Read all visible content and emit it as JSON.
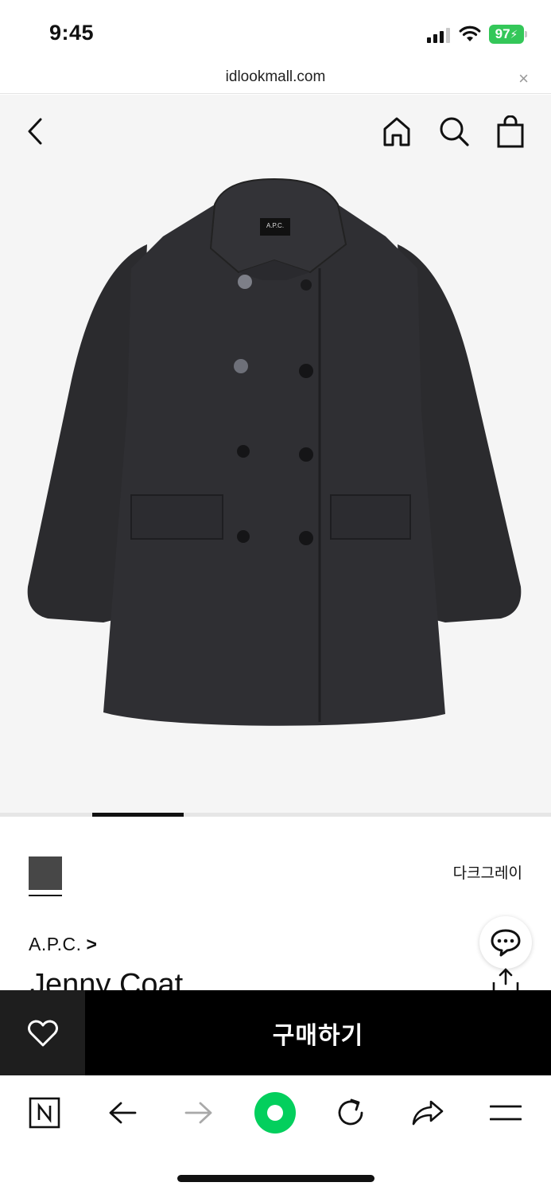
{
  "status_bar": {
    "time": "9:45",
    "battery": "97",
    "icons": [
      "cellular-signal-icon",
      "wifi-icon",
      "battery-charging-icon"
    ]
  },
  "url_bar": {
    "url": "idlookmall.com",
    "close_label": "×"
  },
  "header": {
    "icons": [
      "back-arrow-icon",
      "home-icon",
      "search-icon",
      "shopping-bag-icon"
    ]
  },
  "product": {
    "image_label": "A.P.C.",
    "color_name": "다크그레이",
    "swatch_color": "#474747",
    "brand": "A.P.C.",
    "brand_chevron": ">",
    "name": "Jenny Coat"
  },
  "carousel": {
    "current": 1,
    "total": 6
  },
  "purchase_bar": {
    "buy_label": "구매하기",
    "wish_icon": "heart-icon"
  },
  "browser_toolbar": {
    "icons": [
      "naver-n-icon",
      "back-icon",
      "forward-icon",
      "green-circle-icon",
      "reload-icon",
      "share-icon",
      "menu-icon"
    ]
  },
  "colors": {
    "hero_background": "#f5f5f5",
    "buy_button": "#000000",
    "wish_button": "#1e1e1e",
    "battery": "#34c759",
    "naver_green": "#03cf5d"
  }
}
